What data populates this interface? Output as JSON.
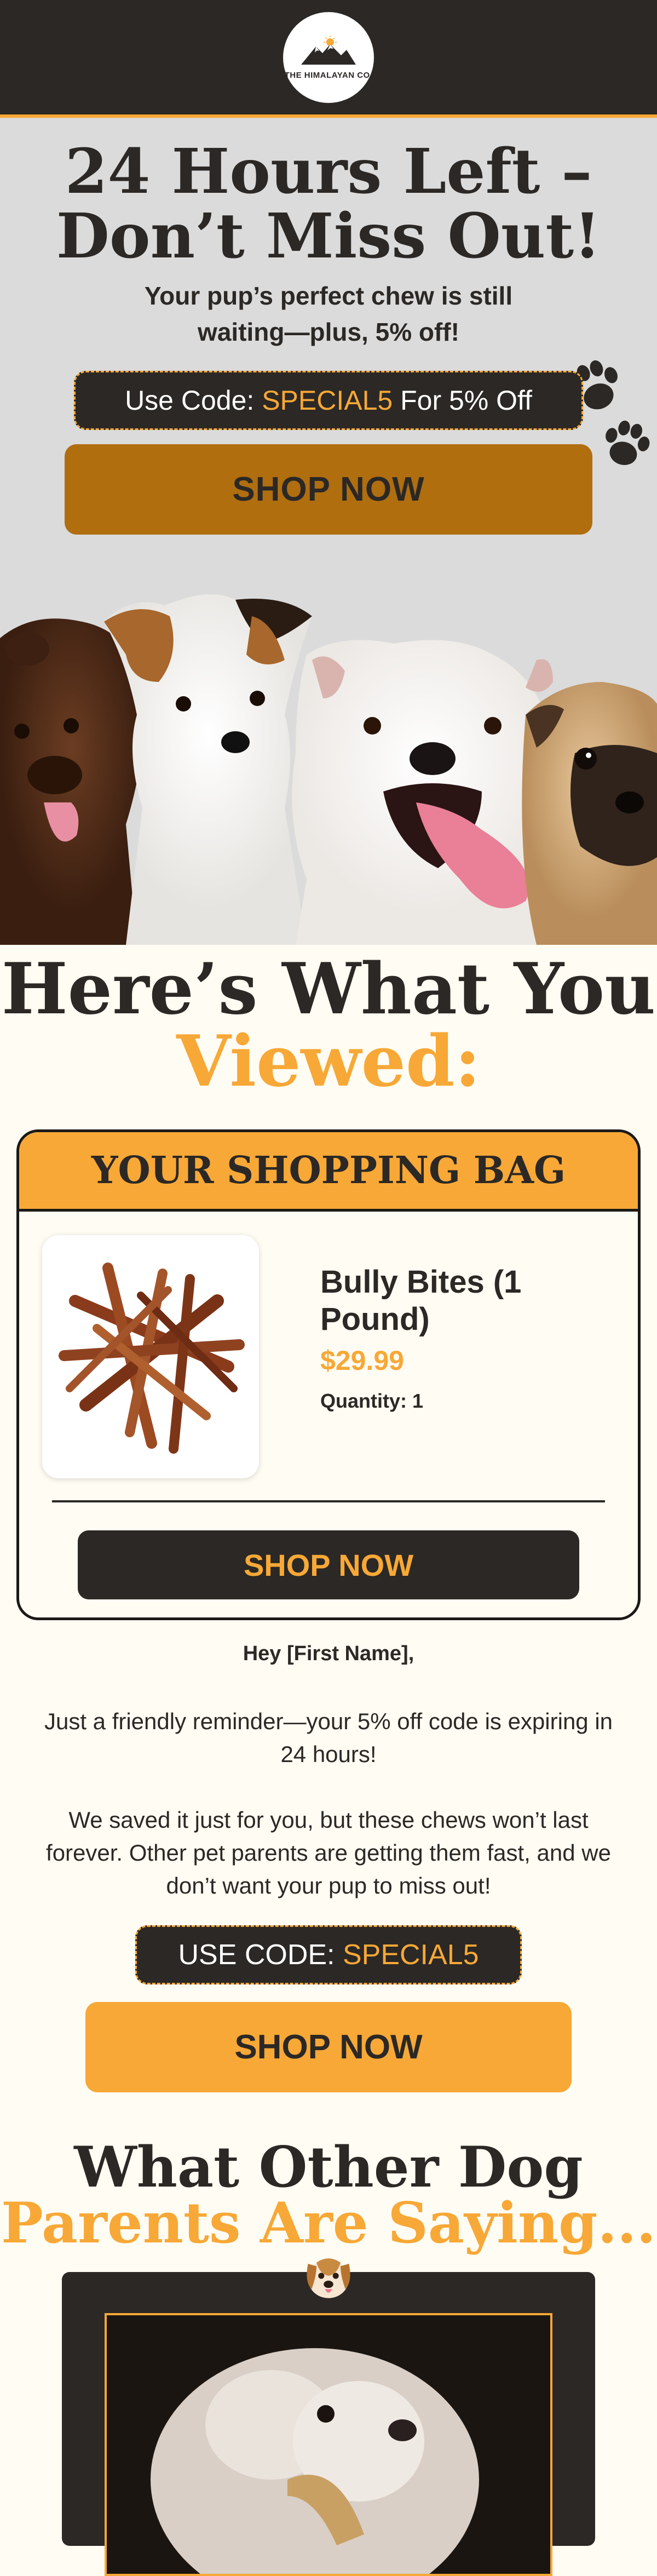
{
  "brand": {
    "logo_text": "THE HIMALAYAN CO."
  },
  "hero": {
    "title_line1": "24 Hours Left –",
    "title_line2": "Don’t Miss Out!",
    "subtitle": "Your pup’s perfect chew is still waiting—plus, 5% off!",
    "code_prefix": "Use Code: ",
    "code": "SPECIAL5",
    "code_suffix": " For 5% Off",
    "cta": "SHOP NOW"
  },
  "viewed": {
    "title_line1": "Here’s What You",
    "title_line2": "Viewed:"
  },
  "bag": {
    "header": "YOUR SHOPPING BAG",
    "product_name": "Bully Bites (1 Pound)",
    "price": "$29.99",
    "quantity": "Quantity: 1",
    "cta": "SHOP NOW"
  },
  "body": {
    "greeting": "Hey [First Name],",
    "para1": "Just a friendly reminder—your 5% off code is expiring in 24 hours!",
    "para2": "We saved it just for you, but these chews won’t last forever. Other pet parents are getting them fast, and we don’t want your pup to miss out!",
    "code_prefix": "USE CODE: ",
    "code": "SPECIAL5",
    "cta": "SHOP NOW"
  },
  "reviews": {
    "title_line1": "What Other Dog",
    "title_line2": "Parents Are Saying..."
  },
  "colors": {
    "accent": "#f7a836",
    "dark": "#2b2825",
    "cream": "#fffcf3",
    "hero_bg": "#dbdbdb",
    "cta_dark_orange": "#b06e0f"
  }
}
